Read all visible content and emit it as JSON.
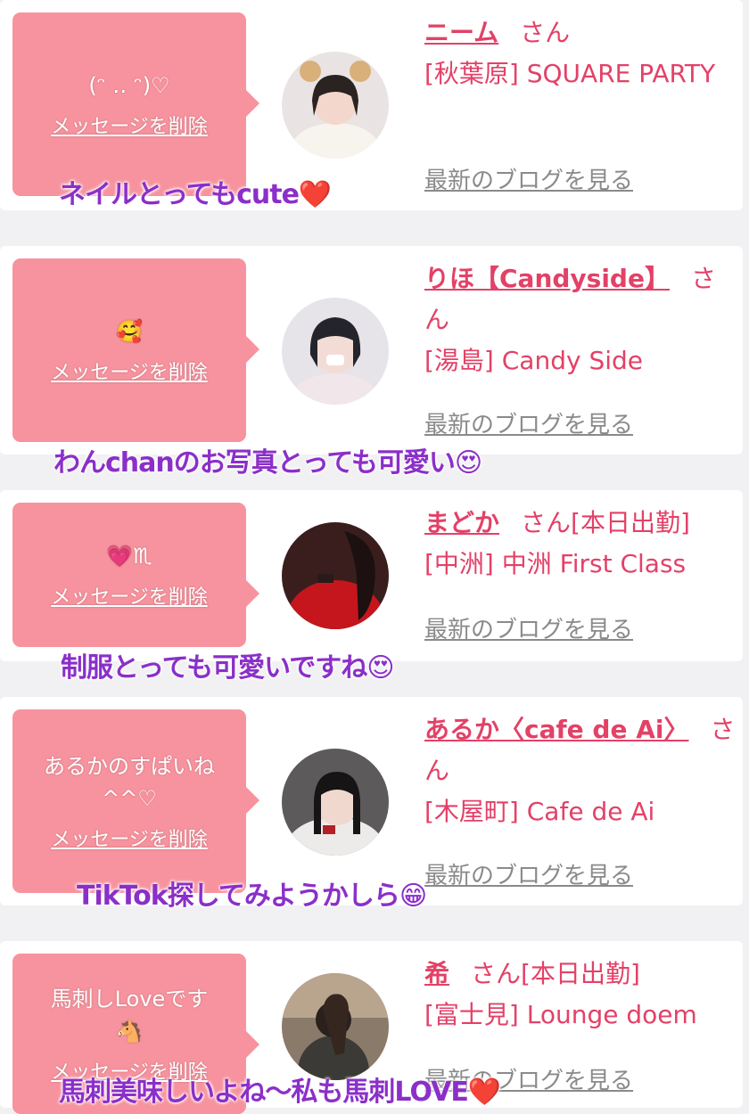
{
  "cards": [
    {
      "message": "(ᵔ ‥ ᵔ)♡",
      "delete_label": "メッセージを削除",
      "name": "ニーム",
      "honorific": "さん",
      "shift": "",
      "shop": "[秋葉原] SQUARE PARTY",
      "blog_label": "最新のブログを見る",
      "caption": "ネイルとってもcute❤️"
    },
    {
      "message": "🥰",
      "delete_label": "メッセージを削除",
      "name": "りほ【Candyside】",
      "honorific": "さん",
      "shift": "",
      "shop": "[湯島] Candy Side",
      "blog_label": "最新のブログを見る",
      "caption": "わんchanのお写真とっても可愛い😍"
    },
    {
      "message": "💗♏︎",
      "delete_label": "メッセージを削除",
      "name": "まどか",
      "honorific": "さん",
      "shift": "[本日出勤]",
      "shop": "[中洲] 中洲 First Class",
      "blog_label": "最新のブログを見る",
      "caption": "制服とっても可愛いですね😍"
    },
    {
      "message": "あるかのすぱいね\n^^♡",
      "delete_label": "メッセージを削除",
      "name": "あるか〈cafe de Ai〉",
      "honorific": "さん",
      "shift": "",
      "shop": "[木屋町] Cafe de Ai",
      "blog_label": "最新のブログを見る",
      "caption": "TikTok探してみようかしら😁"
    },
    {
      "message": "馬刺しLoveです\n🐴",
      "delete_label": "メッセージを削除",
      "name": "希",
      "honorific": "さん",
      "shift": "[本日出勤]",
      "shop": "[富士見] Lounge doem",
      "blog_label": "最新のブログを見る",
      "caption": "馬刺美味しいよね〜私も馬刺LOVE❤️"
    }
  ]
}
